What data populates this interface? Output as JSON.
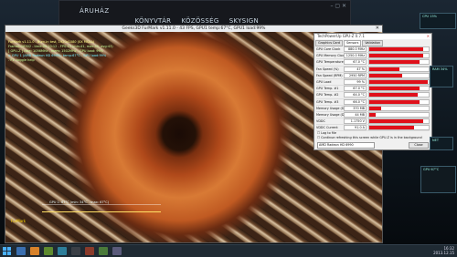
{
  "steam": {
    "logo": "ÁRUHÁZ",
    "nav": [
      "KÖNYVTÁR",
      "KÖZÖSSÉG",
      "SKYSIGN"
    ],
    "window_controls": "– ▢ ✕"
  },
  "furmark": {
    "title": "Geeks3D FurMark v1.11.0 - 43 FPS, GPU1 temp:67°C, GPU1 load:99%",
    "overlay": [
      "FurMark v1.11.0 - Burn-in test, 1920x1080 (0X MSAA)",
      "Frames:26302 - time:00:10:12 - FPS:43 (min:41, max:45, avg:43)",
      "[ GPU-Z ] core: 1056MHz - mem: 1502MHz - GPU load: 99%",
      "> GPU 1 (AMD Radeon HD 6990): temp:67°C - GPU load:99%",
      "- F1: toggle help"
    ],
    "graph_label": "GPU 1: 67°C (min: 34°C - max: 67°C)",
    "logo": "FurMark"
  },
  "gpuz": {
    "title": "TechPowerUp GPU-Z 0.7.1",
    "tabs": [
      "Graphics Card",
      "Sensors",
      "Validation"
    ],
    "active_tab": "Sensors",
    "rows": [
      {
        "name": "GPU Core Clock",
        "value": "880.0 MHz",
        "fill": 0.9
      },
      {
        "name": "GPU Memory Clock",
        "value": "1250.0 MHz",
        "fill": 0.9
      },
      {
        "name": "GPU Temperature",
        "value": "67.0 °C",
        "fill": 0.85
      },
      {
        "name": "Fan Speed (%)",
        "value": "47 %",
        "fill": 0.5
      },
      {
        "name": "Fan Speed (RPM)",
        "value": "2950 RPM",
        "fill": 0.55
      },
      {
        "name": "GPU Load",
        "value": "99 %",
        "fill": 0.99
      },
      {
        "name": "GPU Temp. #1",
        "value": "67.0 °C",
        "fill": 0.85
      },
      {
        "name": "GPU Temp. #2",
        "value": "64.0 °C",
        "fill": 0.82
      },
      {
        "name": "GPU Temp. #3",
        "value": "66.0 °C",
        "fill": 0.84
      },
      {
        "name": "Memory Usage (Dedicated)",
        "value": "370 MB",
        "fill": 0.2
      },
      {
        "name": "Memory Usage (Dynamic)",
        "value": "44 MB",
        "fill": 0.1
      },
      {
        "name": "VDDC",
        "value": "1.1750 V",
        "fill": 0.9
      },
      {
        "name": "VDDC Current",
        "value": "91.0 A",
        "fill": 0.75
      }
    ],
    "options": [
      "Log to file",
      "Continue refreshing this screen while GPU-Z is in the background"
    ],
    "selected_gpu": "AMD Radeon HD 6990",
    "close_label": "Close"
  },
  "gadgets": {
    "g1": "CPU 15%",
    "g2": "RAM 34%",
    "g3": "NET",
    "g4": "GPU 67°C"
  },
  "taskbar": {
    "time": "16:32",
    "date": "2013.12.15"
  },
  "colors": {
    "bar_fill": "#e0101a",
    "overlay_text": "#c8ff9a"
  }
}
